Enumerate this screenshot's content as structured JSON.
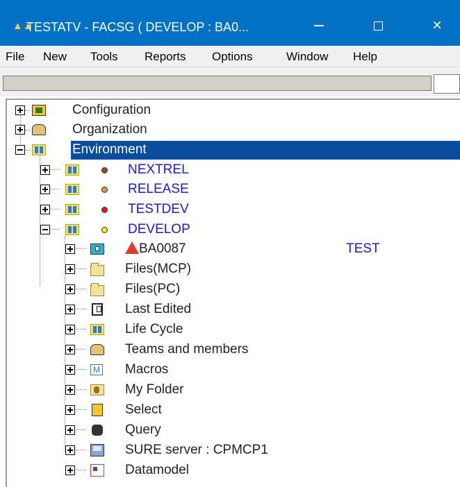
{
  "window": {
    "title": "TESTATV - FACSG ( DEVELOP : BA0...",
    "app_icon": "binoculars-icon",
    "controls": {
      "minimize": "minimize-icon",
      "maximize": "maximize-icon",
      "close": "×"
    }
  },
  "menu": [
    "File",
    "New",
    "Tools",
    "Reports",
    "Options",
    "Window",
    "Help"
  ],
  "toolbar": {
    "status_text": "",
    "speech_icon": "speech-bubble-icon"
  },
  "tree": {
    "root": [
      {
        "label": "Configuration",
        "icon": "configuration-icon",
        "expanded": false
      },
      {
        "label": "Organization",
        "icon": "organization-icon",
        "expanded": false
      },
      {
        "label": "Environment",
        "icon": "environment-icon",
        "expanded": true,
        "selected": true
      }
    ],
    "environments": [
      {
        "label": "NEXTREL",
        "dot_color": "#8b4a2b"
      },
      {
        "label": "RELEASE",
        "dot_color": "#f08a4b"
      },
      {
        "label": "TESTDEV",
        "dot_color": "#e31b1b"
      },
      {
        "label": "DEVELOP",
        "dot_color": "#f4f000",
        "expanded": true
      }
    ],
    "develop_children": [
      {
        "label": "BA0087",
        "icon": "monitor-icon",
        "tag": "TEST"
      },
      {
        "label": "Files(MCP)",
        "icon": "folder-icon"
      },
      {
        "label": "Files(PC)",
        "icon": "folder-icon"
      },
      {
        "label": "Last Edited",
        "icon": "last-edited-icon"
      },
      {
        "label": "Life Cycle",
        "icon": "life-cycle-icon"
      },
      {
        "label": "Teams and members",
        "icon": "teams-icon"
      },
      {
        "label": "Macros",
        "icon": "macros-icon"
      },
      {
        "label": "My Folder",
        "icon": "my-folder-icon"
      },
      {
        "label": "Select",
        "icon": "select-icon"
      },
      {
        "label": "Query",
        "icon": "query-icon"
      },
      {
        "label": "SURE server : CPMCP1",
        "icon": "server-icon"
      },
      {
        "label": "Datamodel",
        "icon": "datamodel-icon"
      }
    ]
  },
  "colors": {
    "titlebar": "#0071c5",
    "selection": "#0a4d9e",
    "env_label": "#1a1adb"
  }
}
